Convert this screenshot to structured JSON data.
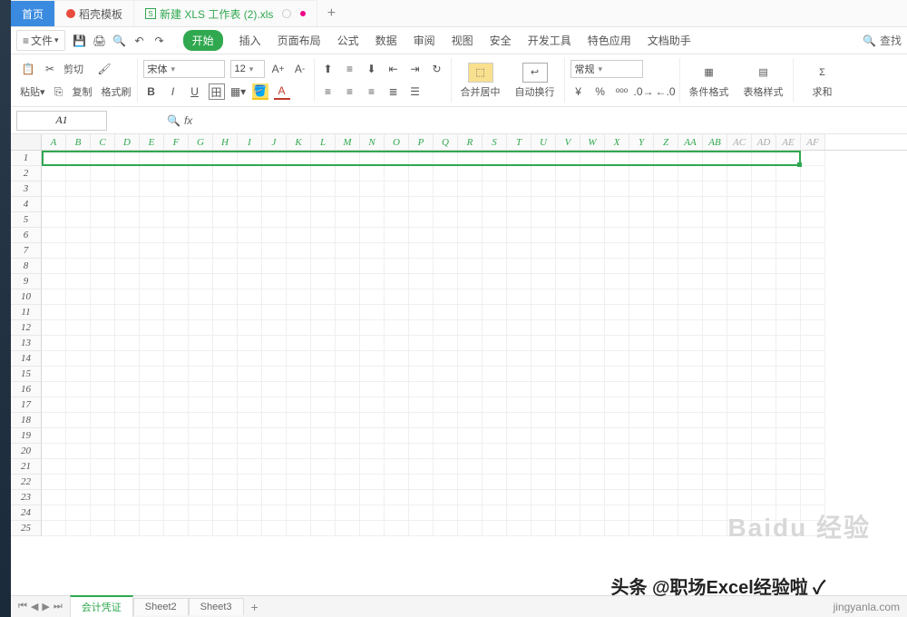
{
  "title_tabs": {
    "t1": "首页",
    "t2": "稻壳模板",
    "t3": "新建 XLS 工作表 (2).xls"
  },
  "file_menu": "文件",
  "menus": [
    "开始",
    "插入",
    "页面布局",
    "公式",
    "数据",
    "审阅",
    "视图",
    "安全",
    "开发工具",
    "特色应用",
    "文档助手"
  ],
  "search": "查找",
  "clipboard": {
    "cut": "剪切",
    "copy": "复制",
    "format": "格式刷"
  },
  "font": {
    "name": "宋体",
    "size": "12"
  },
  "align": {},
  "merge": {
    "label": "合并居中",
    "wrap": "自动换行"
  },
  "number": {
    "format": "常规"
  },
  "style": {
    "cond": "条件格式",
    "table": "表格样式"
  },
  "last": {
    "label": "求和"
  },
  "namebox": "A1",
  "fx": "fx",
  "cols_full": [
    "A",
    "B",
    "C",
    "D",
    "E",
    "F",
    "G",
    "H",
    "I",
    "J",
    "K",
    "L",
    "M",
    "N",
    "O",
    "P",
    "Q",
    "R",
    "S",
    "T",
    "U",
    "V",
    "W",
    "X",
    "Y",
    "Z",
    "AA",
    "AB",
    "AC",
    "AD",
    "AE",
    "AF"
  ],
  "rows": [
    "1",
    "2",
    "3",
    "4",
    "5",
    "6",
    "7",
    "8",
    "9",
    "10",
    "11",
    "12",
    "13",
    "14",
    "15",
    "16",
    "17",
    "18",
    "19",
    "20",
    "21",
    "22",
    "23",
    "24",
    "25"
  ],
  "sheets": {
    "s1": "会计凭证",
    "s2": "Sheet2",
    "s3": "Sheet3"
  },
  "watermark": "Baidu 经验",
  "credit1": "头条 @职场Excel经验啦 ✓",
  "credit2": "jingyanla.com",
  "chart_data": null
}
